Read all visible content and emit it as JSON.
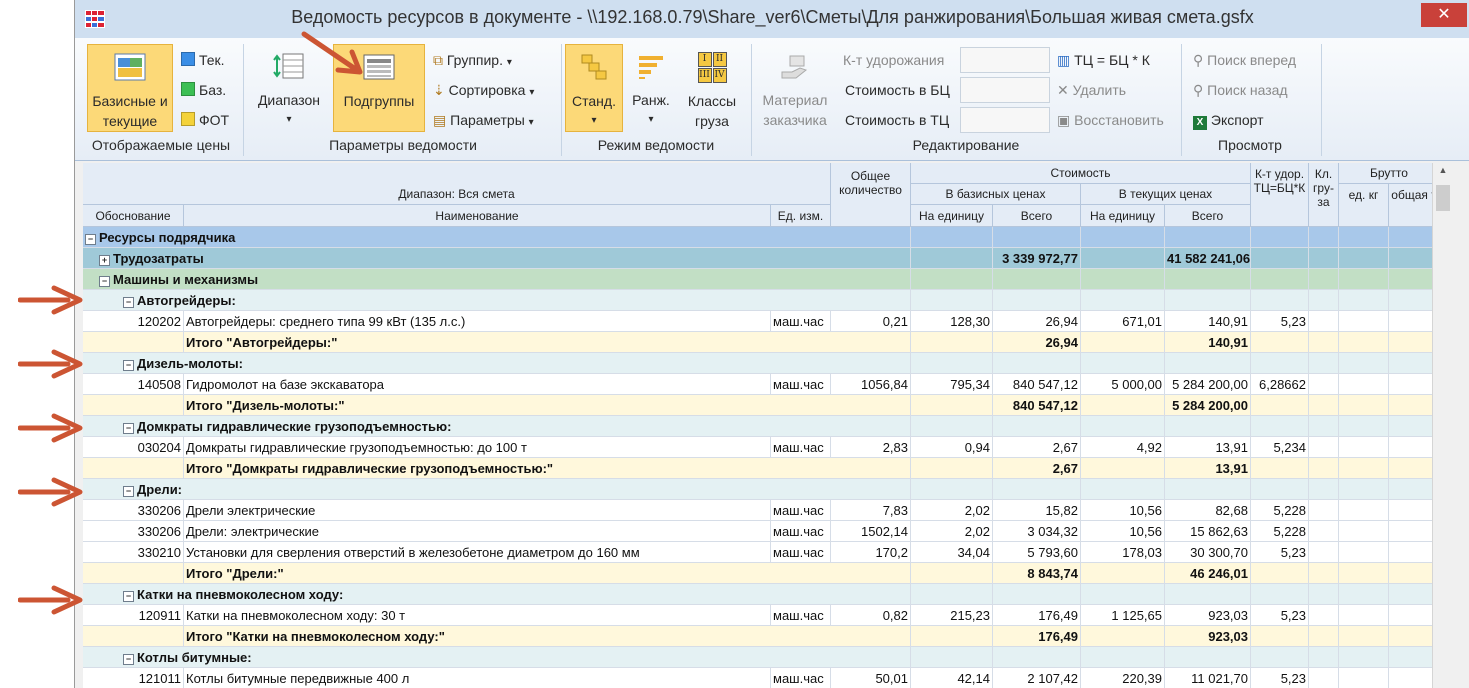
{
  "window": {
    "title": "Ведомость ресурсов в документе - \\\\192.168.0.79\\Share_ver6\\Сметы\\Для ранжирования\\Большая живая смета.gsfx",
    "close": "✕"
  },
  "colors": {
    "accent": "#fcd978",
    "section": "#a8c8ea",
    "group_teal": "#9fc9d8",
    "group_green": "#c2dfc5",
    "subgroup": "#e4f1f3",
    "total": "#fff8dc",
    "arrow": "#cc5533"
  },
  "ribbon": {
    "displayed_prices": {
      "label": "Отображаемые цены",
      "base_current": "Базисные и текущие",
      "current": "Тек.",
      "base": "Баз.",
      "fot": "ФОТ"
    },
    "params": {
      "label": "Параметры ведомости",
      "range": "Диапазон",
      "subgroups": "Подгруппы",
      "group": "Группир.",
      "sort": "Сортировка",
      "params": "Параметры"
    },
    "mode": {
      "label": "Режим ведомости",
      "standard": "Станд.",
      "rank": "Ранж.",
      "cargo": "Классы груза",
      "cargo_icon": [
        "I",
        "II",
        "III",
        "IV"
      ]
    },
    "edit": {
      "label": "Редактирование",
      "material": "Материал заказчика",
      "coef": "К-т удорожания",
      "cost_bc": "Стоимость в БЦ",
      "cost_tc": "Стоимость в ТЦ",
      "formula": "ТЦ = БЦ * К",
      "delete": "Удалить",
      "restore": "Восстановить"
    },
    "view": {
      "label": "Просмотр",
      "search_fwd": "Поиск вперед",
      "search_back": "Поиск назад",
      "export": "Экспорт"
    }
  },
  "table": {
    "headers": {
      "range": "Диапазон: Вся смета",
      "code": "Обоснование",
      "name": "Наименование",
      "unit": "Ед. изм.",
      "qty": "Общее количество",
      "cost": "Стоимость",
      "base": "В базисных ценах",
      "current": "В текущих ценах",
      "per_unit": "На единицу",
      "total": "Всего",
      "per_unit2": "На единицу",
      "total2": "Всего",
      "coef": "К-т удор. ТЦ=БЦ*К",
      "cargo": "Кл. гру-за",
      "brutto": "Брутто",
      "unit_kg": "ед. кг",
      "total_t": "общая т"
    },
    "rows": [
      {
        "t": "section",
        "pm": "⊟",
        "name": "Ресурсы подрядчика"
      },
      {
        "t": "group1",
        "pm": "⊞",
        "name": "Трудозатраты",
        "base_total": "3 339 972,77",
        "cur_total": "41 582 241,06"
      },
      {
        "t": "group2",
        "pm": "⊟",
        "name": "Машины и механизмы"
      },
      {
        "t": "sub",
        "pm": "⊟",
        "name": "Автогрейдеры:"
      },
      {
        "t": "item",
        "code": "120202",
        "name": "Автогрейдеры: среднего типа 99 кВт (135 л.с.)",
        "unit": "маш.час",
        "qty": "0,21",
        "bu": "128,30",
        "bt": "26,94",
        "cu": "671,01",
        "ct": "140,91",
        "k": "5,23"
      },
      {
        "t": "total",
        "name": "Итого \"Автогрейдеры:\"",
        "bt": "26,94",
        "ct": "140,91"
      },
      {
        "t": "sub",
        "pm": "⊟",
        "name": "Дизель-молоты:"
      },
      {
        "t": "item",
        "code": "140508",
        "name": "Гидромолот на базе экскаватора",
        "unit": "маш.час",
        "qty": "1056,84",
        "bu": "795,34",
        "bt": "840 547,12",
        "cu": "5 000,00",
        "ct": "5 284 200,00",
        "k": "6,28662"
      },
      {
        "t": "total",
        "name": "Итого \"Дизель-молоты:\"",
        "bt": "840 547,12",
        "ct": "5 284 200,00"
      },
      {
        "t": "sub",
        "pm": "⊟",
        "name": "Домкраты гидравлические грузоподъемностью:"
      },
      {
        "t": "item",
        "code": "030204",
        "name": "Домкраты гидравлические грузоподъемностью: до 100 т",
        "unit": "маш.час",
        "qty": "2,83",
        "bu": "0,94",
        "bt": "2,67",
        "cu": "4,92",
        "ct": "13,91",
        "k": "5,234"
      },
      {
        "t": "total",
        "name": "Итого \"Домкраты гидравлические грузоподъемностью:\"",
        "bt": "2,67",
        "ct": "13,91"
      },
      {
        "t": "sub",
        "pm": "⊟",
        "name": "Дрели:"
      },
      {
        "t": "item",
        "code": "330206",
        "name": "Дрели электрические",
        "unit": "маш.час",
        "qty": "7,83",
        "bu": "2,02",
        "bt": "15,82",
        "cu": "10,56",
        "ct": "82,68",
        "k": "5,228"
      },
      {
        "t": "item",
        "code": "330206",
        "name": "Дрели: электрические",
        "unit": "маш.час",
        "qty": "1502,14",
        "bu": "2,02",
        "bt": "3 034,32",
        "cu": "10,56",
        "ct": "15 862,63",
        "k": "5,228"
      },
      {
        "t": "item",
        "code": "330210",
        "name": "Установки для сверления отверстий в железобетоне диаметром до 160 мм",
        "unit": "маш.час",
        "qty": "170,2",
        "bu": "34,04",
        "bt": "5 793,60",
        "cu": "178,03",
        "ct": "30 300,70",
        "k": "5,23"
      },
      {
        "t": "total",
        "name": "Итого \"Дрели:\"",
        "bt": "8 843,74",
        "ct": "46 246,01"
      },
      {
        "t": "sub",
        "pm": "⊟",
        "name": "Катки на пневмоколесном ходу:"
      },
      {
        "t": "item",
        "code": "120911",
        "name": "Катки на пневмоколесном ходу: 30 т",
        "unit": "маш.час",
        "qty": "0,82",
        "bu": "215,23",
        "bt": "176,49",
        "cu": "1 125,65",
        "ct": "923,03",
        "k": "5,23"
      },
      {
        "t": "total",
        "name": "Итого \"Катки на пневмоколесном ходу:\"",
        "bt": "176,49",
        "ct": "923,03"
      },
      {
        "t": "sub",
        "pm": "⊟",
        "name": "Котлы битумные:"
      },
      {
        "t": "item",
        "code": "121011",
        "name": "Котлы битумные передвижные 400 л",
        "unit": "маш.час",
        "qty": "50,01",
        "bu": "42,14",
        "bt": "2 107,42",
        "cu": "220,39",
        "ct": "11 021,70",
        "k": "5,23"
      }
    ]
  }
}
